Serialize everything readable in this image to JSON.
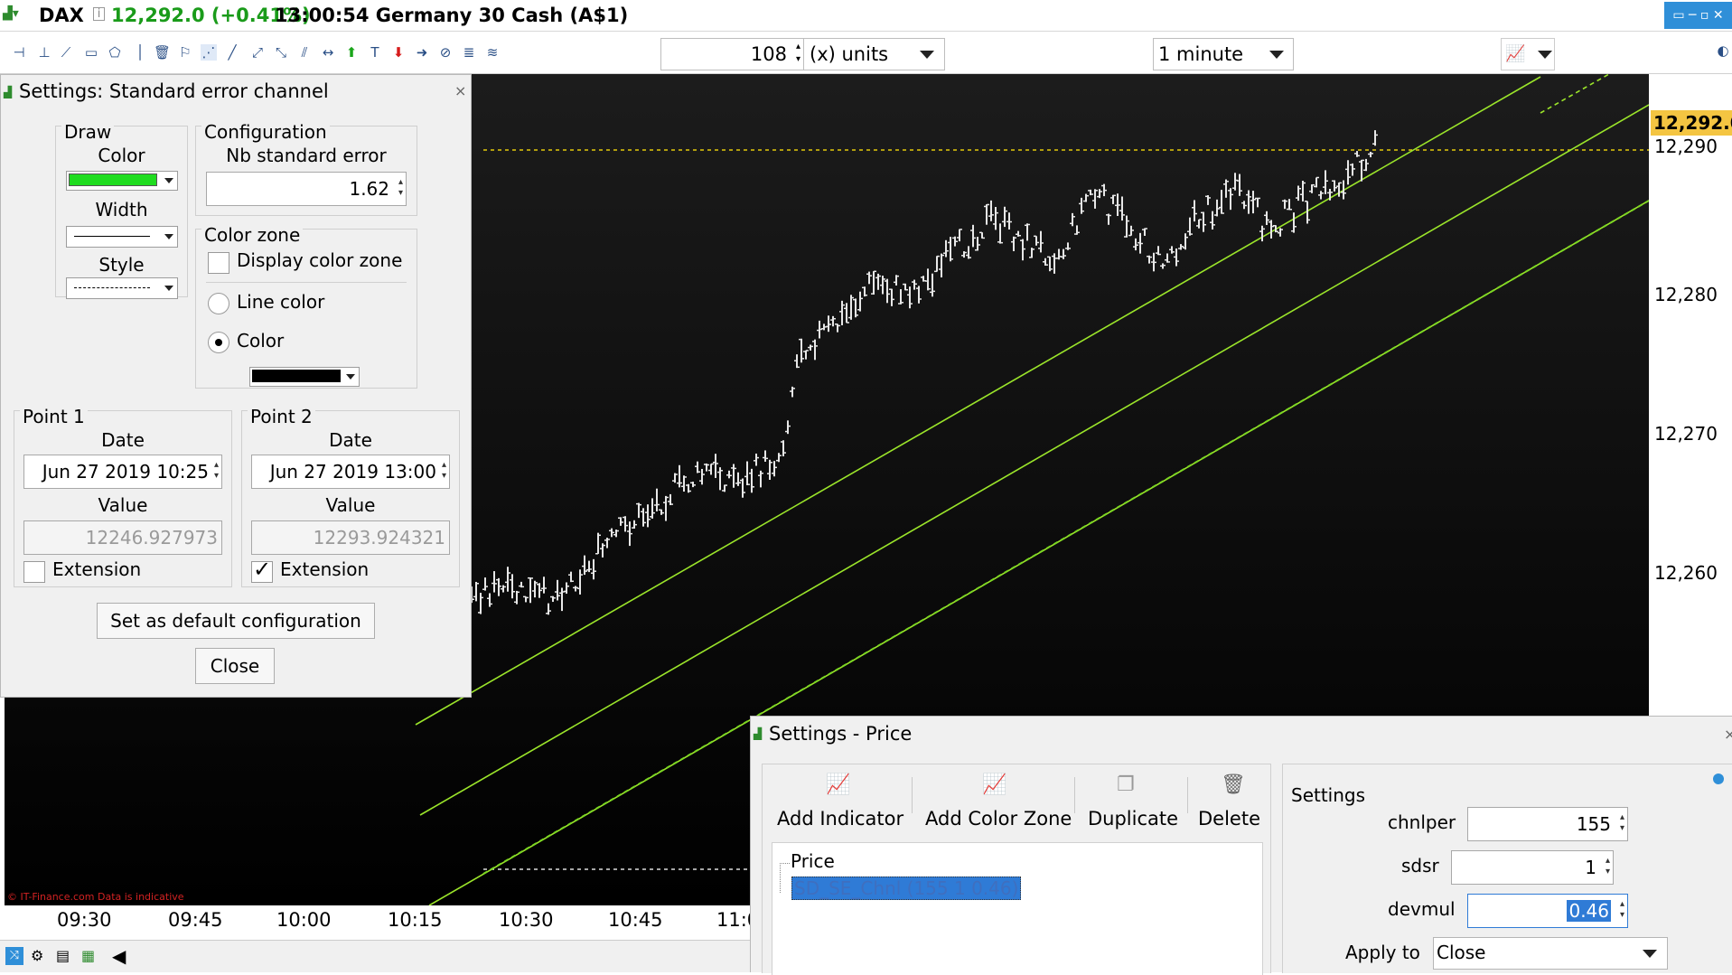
{
  "header": {
    "instrument": "DAX",
    "price_change": "12,292.0 (+0.41%)",
    "time_name": "13:00:54 Germany 30 Cash (A$1)"
  },
  "toolbar": {
    "units_value": "108",
    "units_label": "(x) units",
    "timeframe": "1 minute"
  },
  "chart": {
    "y_ticks": [
      "12,290",
      "12,280",
      "12,270",
      "12,260"
    ],
    "current_price": "12,292.0",
    "x_ticks": [
      "09:30",
      "09:45",
      "10:00",
      "10:15",
      "10:30",
      "10:45",
      "11:0"
    ],
    "watermark": "© IT-Finance.com  Data is indicative",
    "colors": {
      "channel": "#9be52a",
      "price_line": "#e3c90a",
      "candles": "#e8e8e8",
      "background_top": "#1c1c1c"
    }
  },
  "settings_dialog": {
    "title": "Settings: Standard error channel",
    "close": "×",
    "draw": {
      "title": "Draw",
      "color_label": "Color",
      "width_label": "Width",
      "style_label": "Style",
      "color": "#1fdc1f"
    },
    "configuration": {
      "title": "Configuration",
      "nb_label": "Nb standard error",
      "nb_value": "1.62"
    },
    "color_zone": {
      "title": "Color zone",
      "display_label": "Display color zone",
      "line_color_label": "Line color",
      "color_label": "Color",
      "color": "#000000"
    },
    "point1": {
      "title": "Point 1",
      "date_label": "Date",
      "date": "Jun 27 2019 10:25",
      "value_label": "Value",
      "value": "12246.927973",
      "extension_label": "Extension"
    },
    "point2": {
      "title": "Point 2",
      "date_label": "Date",
      "date": "Jun 27 2019 13:00",
      "value_label": "Value",
      "value": "12293.924321",
      "extension_label": "Extension"
    },
    "default_button": "Set as default configuration",
    "close_button": "Close"
  },
  "price_dialog": {
    "title": "Settings - Price",
    "close": "×",
    "actions": [
      "Add Indicator",
      "Add Color Zone",
      "Duplicate",
      "Delete"
    ],
    "tree_root": "Price",
    "tree_item": "SD_SE_Chnl (155 1 0.46)",
    "settings_title": "Settings",
    "params": [
      {
        "label": "chnlper",
        "value": "155"
      },
      {
        "label": "sdsr",
        "value": "1"
      },
      {
        "label": "devmul",
        "value": "0.46"
      }
    ],
    "apply_label": "Apply to",
    "apply_value": "Close"
  }
}
